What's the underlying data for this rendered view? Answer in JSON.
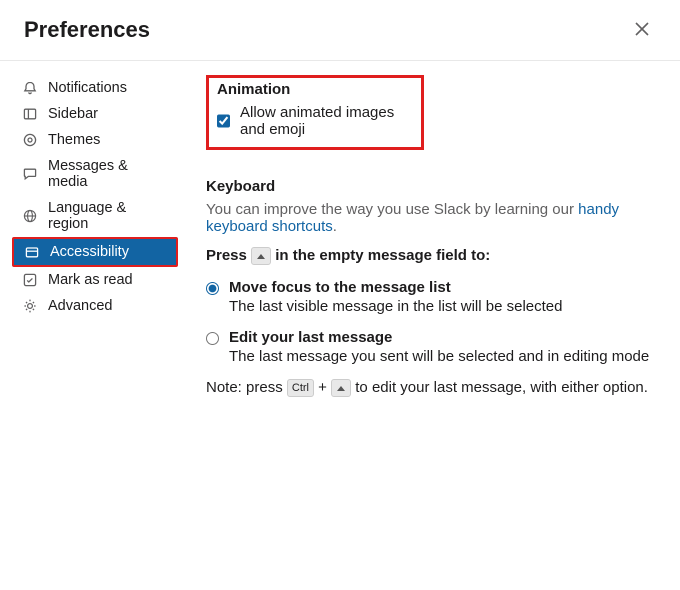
{
  "header": {
    "title": "Preferences"
  },
  "sidebar": {
    "items": [
      {
        "label": "Notifications"
      },
      {
        "label": "Sidebar"
      },
      {
        "label": "Themes"
      },
      {
        "label": "Messages & media"
      },
      {
        "label": "Language & region"
      },
      {
        "label": "Accessibility"
      },
      {
        "label": "Mark as read"
      },
      {
        "label": "Advanced"
      }
    ]
  },
  "animation": {
    "title": "Animation",
    "checkbox_label": "Allow animated images and emoji"
  },
  "keyboard": {
    "title": "Keyboard",
    "desc_prefix": "You can improve the way you use Slack by learning our ",
    "link": "handy keyboard shortcuts",
    "link_period": ".",
    "press_prefix": "Press ",
    "press_suffix": " in the empty message field to:",
    "radios": [
      {
        "label": "Move focus to the message list",
        "desc": "The last visible message in the list will be selected"
      },
      {
        "label": "Edit your last message",
        "desc": "The last message you sent will be selected and in editing mode"
      }
    ],
    "note_prefix": "Note: press ",
    "note_ctrl": "Ctrl",
    "note_plus": " + ",
    "note_suffix": " to edit your last message, with either option."
  }
}
